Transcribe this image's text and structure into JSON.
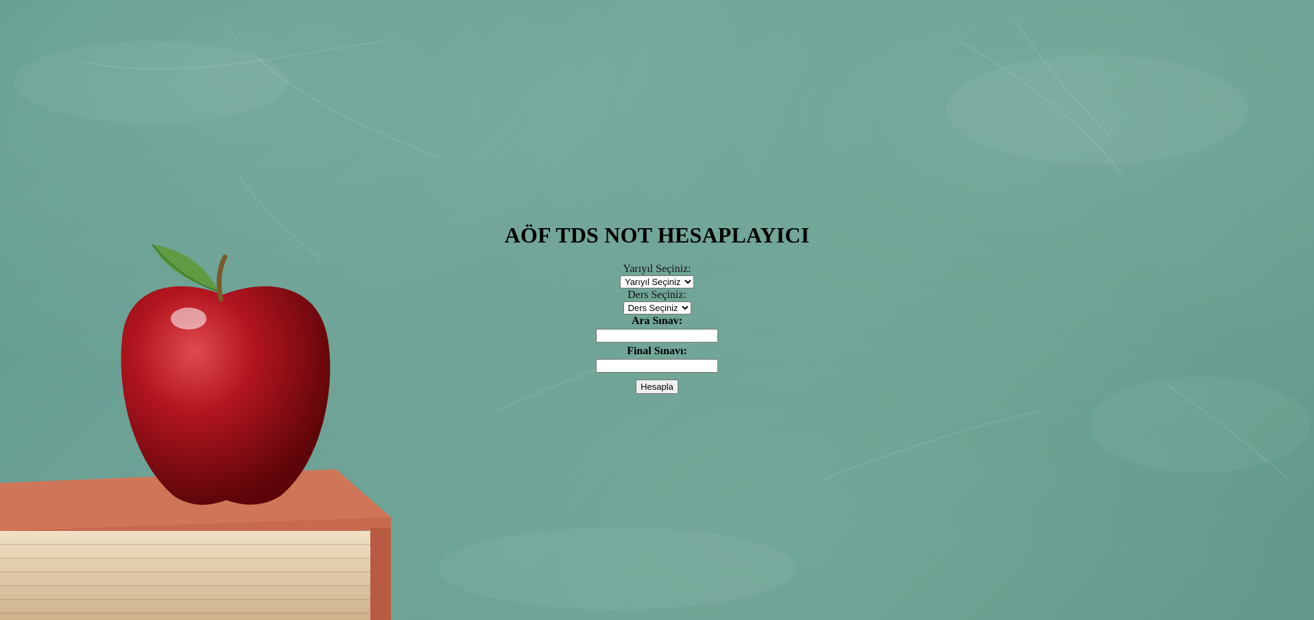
{
  "page": {
    "title": "AÖF TDS NOT HESAPLAYICI"
  },
  "form": {
    "semester_label": "Yarıyıl Seçiniz:",
    "semester_selected": "Yarıyıl Seçiniz",
    "course_label": "Ders Seçiniz:",
    "course_selected": "Ders Seçiniz",
    "midterm_label": "Ara Sınav:",
    "midterm_value": "",
    "final_label": "Final Sınavı:",
    "final_value": "",
    "calculate_label": "Hesapla"
  },
  "background": {
    "description_icons": [
      "chalkboard-background",
      "apple-icon",
      "book-icon"
    ],
    "colors": {
      "chalkboard": "#6aa293",
      "apple": "#a3121c",
      "book_cover": "#c8674e",
      "book_pages": "#e7d3b4"
    }
  }
}
